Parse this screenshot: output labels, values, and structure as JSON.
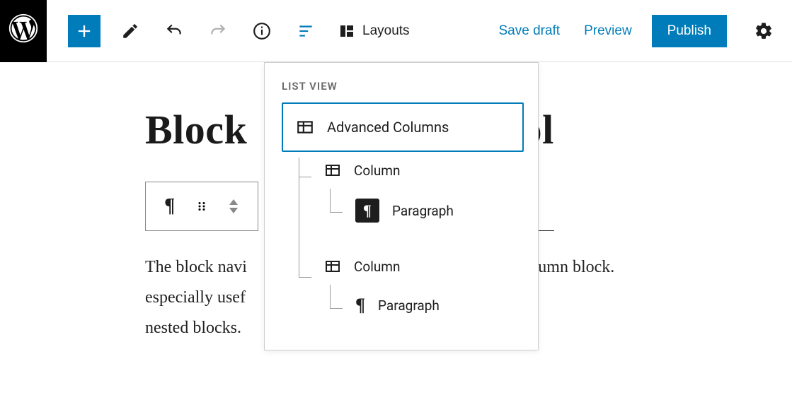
{
  "toolbar": {
    "layouts_label": "Layouts",
    "save_draft": "Save draft",
    "preview": "Preview",
    "publish": "Publish"
  },
  "content": {
    "title_partial_left": "Block",
    "title_partial_right": "ool",
    "body_line1_left": "The block navi",
    "body_line1_right": " column block.",
    "body_line2": "especially usef",
    "body_line3": "nested blocks."
  },
  "listview": {
    "header": "LIST VIEW",
    "root": "Advanced Columns",
    "items": [
      {
        "label": "Column",
        "children": [
          {
            "label": "Paragraph",
            "highlight": true
          }
        ]
      },
      {
        "label": "Column",
        "children": [
          {
            "label": "Paragraph",
            "highlight": false
          }
        ]
      }
    ]
  }
}
